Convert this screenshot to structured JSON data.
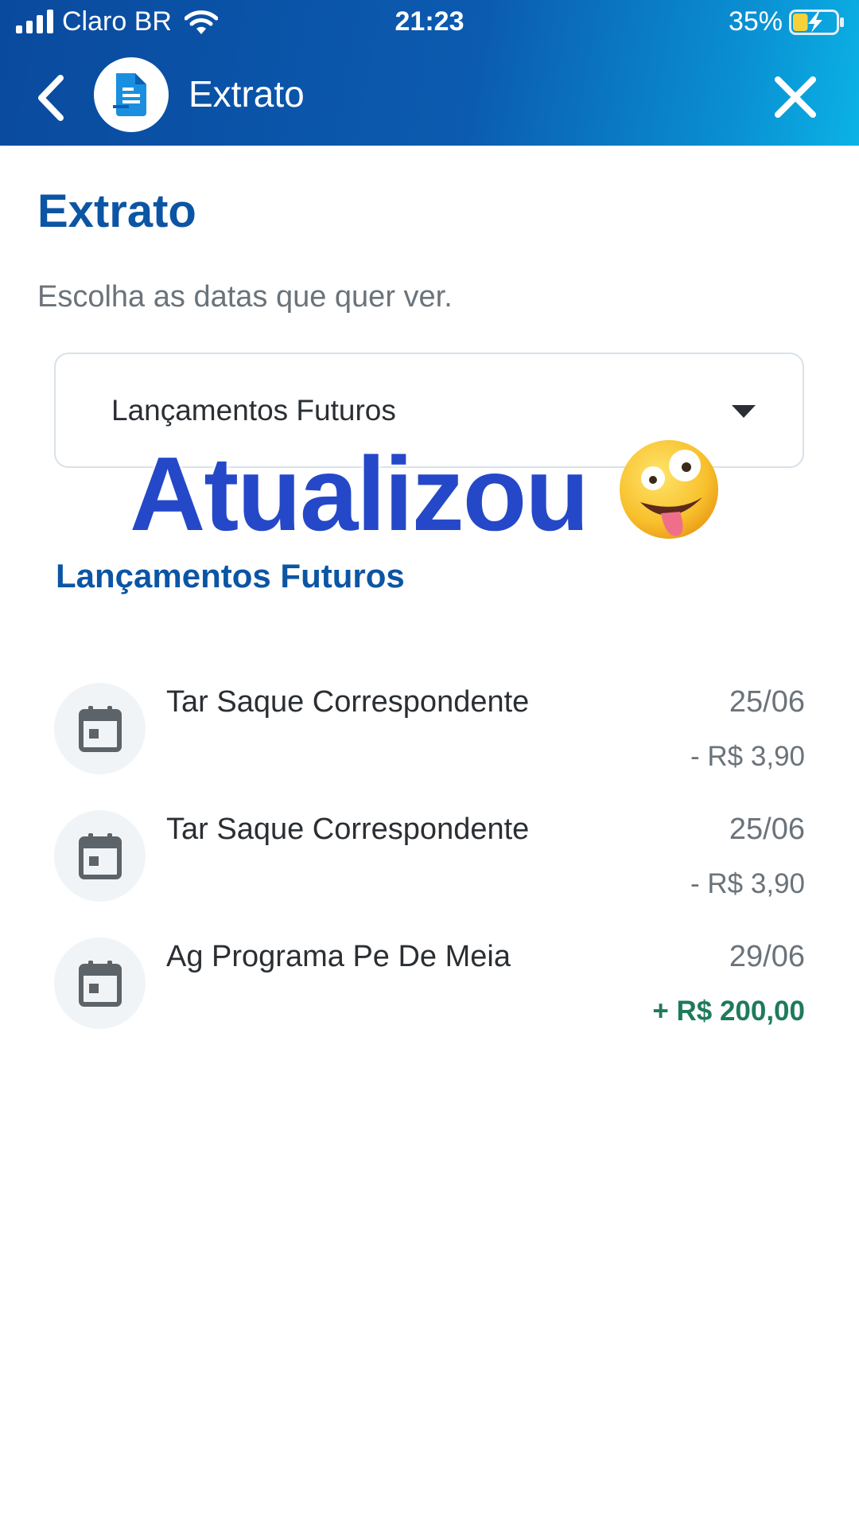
{
  "status_bar": {
    "carrier": "Claro BR",
    "time": "21:23",
    "battery": "35%",
    "battery_level": 0.35
  },
  "navbar": {
    "title": "Extrato",
    "back_icon": "chevron-left-icon",
    "avatar_icon": "document-icon",
    "close_icon": "close-icon"
  },
  "page": {
    "title": "Extrato",
    "subtitle": "Escolha as datas que quer ver."
  },
  "period_select": {
    "selected": "Lançamentos Futuros",
    "icon": "caret-down-icon"
  },
  "sticker": {
    "text": "Atualizou",
    "emoji": "zany-face-emoji"
  },
  "section": {
    "title": "Lançamentos Futuros"
  },
  "transactions": [
    {
      "description": "Tar Saque Correspondente",
      "date": "25/06",
      "amount": "- R$ 3,90",
      "direction": "debit",
      "icon": "calendar-icon"
    },
    {
      "description": "Tar Saque Correspondente",
      "date": "25/06",
      "amount": "- R$ 3,90",
      "direction": "debit",
      "icon": "calendar-icon"
    },
    {
      "description": "Ag Programa Pe De Meia",
      "date": "29/06",
      "amount": "+ R$ 200,00",
      "direction": "credit",
      "icon": "calendar-icon"
    }
  ],
  "colors": {
    "header_start": "#0a4a9e",
    "header_end": "#0bb2e6",
    "primary_text": "#0b55a4",
    "credit": "#1f7a5c",
    "muted": "#6b737a"
  }
}
